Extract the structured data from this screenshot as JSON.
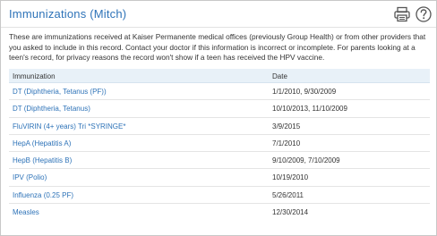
{
  "header": {
    "title": "Immunizations (Mitch)",
    "print_icon": "printer-icon",
    "help_icon": "question-icon"
  },
  "intro_text": "These are immunizations received at Kaiser Permanente medical offices (previously Group Health) or from other providers that you asked to include in this record. Contact your doctor if this information is incorrect or incomplete. For parents looking at a teen's record, for privacy reasons the record won't show if a teen has received the HPV vaccine.",
  "table": {
    "columns": [
      "Immunization",
      "Date"
    ],
    "rows": [
      {
        "name": "DT (Diphtheria, Tetanus (PF))",
        "date": "1/1/2010,  9/30/2009"
      },
      {
        "name": "DT (Diphtheria, Tetanus)",
        "date": "10/10/2013,  11/10/2009"
      },
      {
        "name": "FluVIRIN (4+ years) Tri *SYRINGE*",
        "date": "3/9/2015"
      },
      {
        "name": "HepA (Hepatitis A)",
        "date": "7/1/2010"
      },
      {
        "name": "HepB (Hepatitis B)",
        "date": "9/10/2009,  7/10/2009"
      },
      {
        "name": "IPV (Polio)",
        "date": "10/19/2010"
      },
      {
        "name": "Influenza (0.25 PF)",
        "date": "5/26/2011"
      },
      {
        "name": "Measles",
        "date": "12/30/2014"
      }
    ]
  },
  "colors": {
    "link": "#2e73b8",
    "header_bg": "#e8f1f8",
    "text": "#333333"
  }
}
